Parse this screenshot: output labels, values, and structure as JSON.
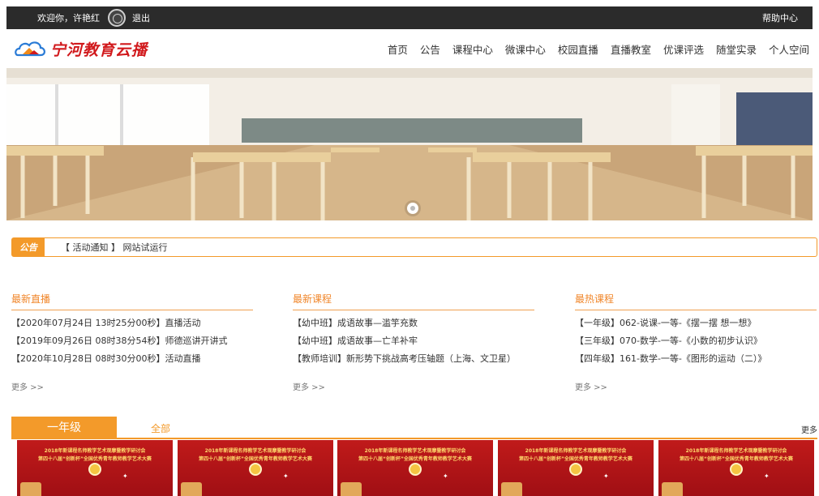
{
  "topbar": {
    "welcome": "欢迎你，许艳红",
    "logout": "退出",
    "help": "帮助中心"
  },
  "header": {
    "logo_text": "宁河教育云播",
    "nav": [
      "首页",
      "公告",
      "课程中心",
      "微课中心",
      "校园直播",
      "直播教室",
      "优课评选",
      "随堂实录",
      "个人空间"
    ]
  },
  "notice": {
    "tag": "公告",
    "text": "【 活动通知 】 网站试运行"
  },
  "sections": {
    "live": {
      "title": "最新直播",
      "items": [
        "【2020年07月24日 13时25分00秒】直播活动",
        "【2019年09月26日 08时38分54秒】师德巡讲开讲式",
        "【2020年10月28日 08时30分00秒】活动直播"
      ],
      "more": "更多 >>"
    },
    "courses": {
      "title": "最新课程",
      "items": [
        "【幼中班】成语故事—滥竽充数",
        "【幼中班】成语故事—亡羊补牢",
        "【教师培训】新形势下挑战高考压轴题（上海、文卫星）"
      ],
      "more": "更多 >>"
    },
    "hot": {
      "title": "最热课程",
      "items": [
        "【一年级】062-说课-一等-《摆一摆 想一想》",
        "【三年级】070-数学-一等-《小数的初步认识》",
        "【四年级】161-数学-一等-《图形的运动（二）》"
      ],
      "more": "更多 >>"
    }
  },
  "tabs": {
    "active": "一年级",
    "all": "全部",
    "more": "更多"
  },
  "card": {
    "line1": "2018年新课程名师教学艺术观摩暨教学研讨会",
    "line2": "第四十八届“创新杯”全国优秀青年教师教学艺术大赛"
  },
  "colors": {
    "accent": "#f39a2a",
    "topbar": "#2b2b2b",
    "logo": "#d1191c"
  }
}
